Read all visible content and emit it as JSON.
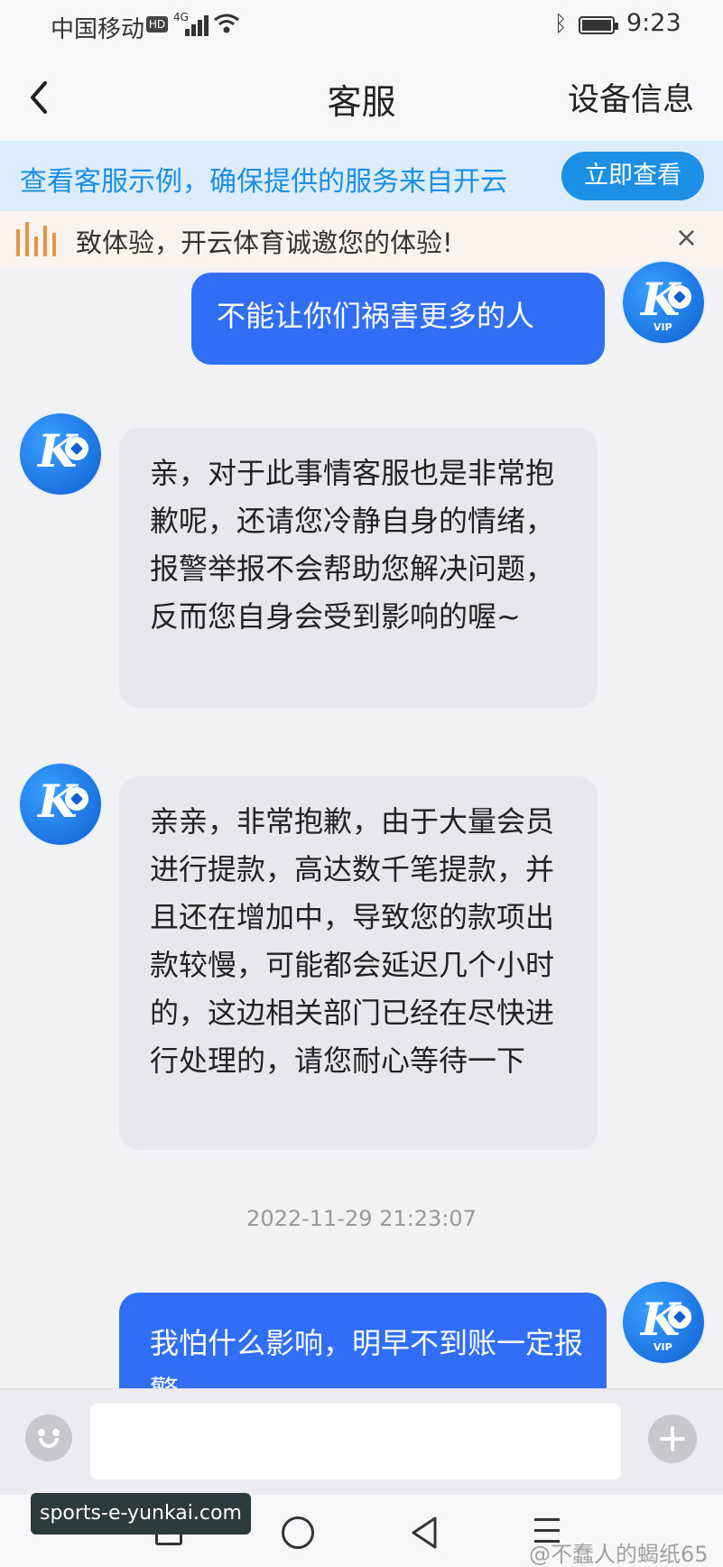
{
  "status_bar": {
    "carrier": "中国移动",
    "hd_badge": "HD",
    "network": "4G",
    "time": "9:23",
    "icons": [
      "signal-icon",
      "wifi-icon",
      "bluetooth-icon",
      "battery-icon"
    ]
  },
  "nav": {
    "back_icon": "chevron-left-icon",
    "title": "客服",
    "right_action": "设备信息"
  },
  "promo": {
    "text": "查看客服示例，确保提供的服务来自开云",
    "button": "立即查看",
    "accent": "#1c8fe6"
  },
  "notice": {
    "icon": "sound-icon",
    "text": "致体验，开云体育诚邀您的体验!",
    "close": "×"
  },
  "avatar": {
    "logo": "K",
    "vip": "VIP"
  },
  "messages": [
    {
      "side": "out",
      "text": "不能让你们祸害更多的人"
    },
    {
      "side": "in",
      "text": "亲，对于此事情客服也是非常抱歉呢，还请您冷静自身的情绪，报警举报不会帮助您解决问题，反而您自身会受到影响的喔~"
    },
    {
      "side": "in",
      "text": "亲亲，非常抱歉，由于大量会员进行提款，高达数千笔提款，并且还在增加中，导致您的款项出款较慢，可能都会延迟几个小时的，这边相关部门已经在尽快进行处理的，请您耐心等待一下"
    },
    {
      "side": "out",
      "text": "我怕什么影响，明早不到账一定报警"
    }
  ],
  "timestamp": "2022-11-29 21:23:07",
  "input_bar": {
    "emoji_icon": "emoji-icon",
    "plus_icon": "plus-icon",
    "value": ""
  },
  "watermarks": {
    "left": "sports-e-yunkai.com",
    "right": "@不蠢人的蝎纸65"
  },
  "colors": {
    "outgoing_bubble": "#2f6ef5",
    "incoming_bubble": "#e7e7ec",
    "notice_icon": "#e59344"
  }
}
